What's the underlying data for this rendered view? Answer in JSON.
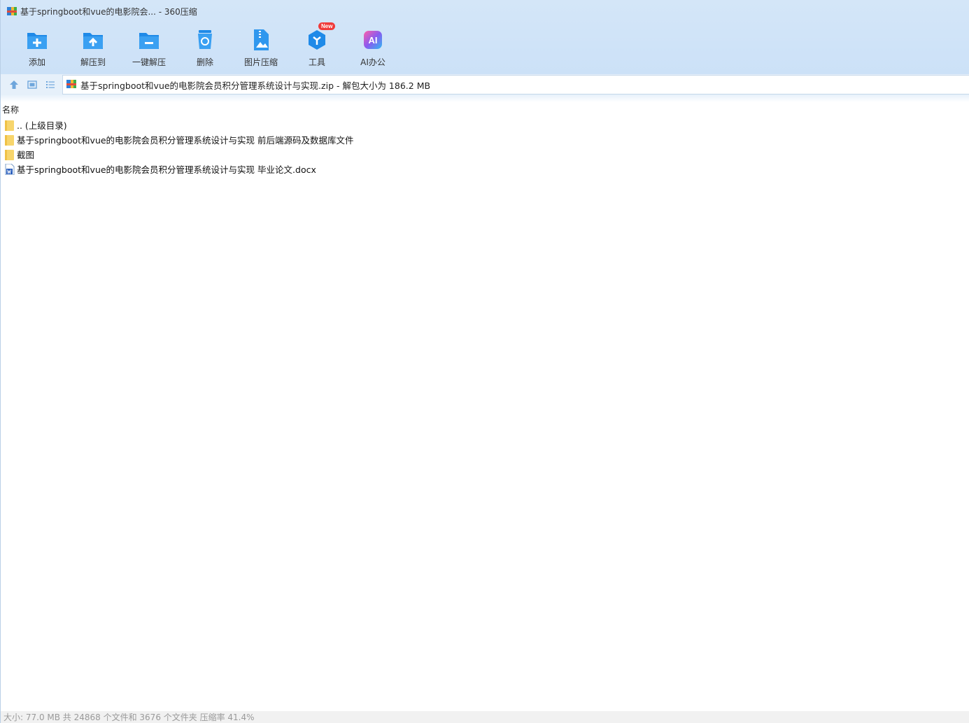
{
  "window": {
    "title": "基于springboot和vue的电影院会... - 360压缩"
  },
  "toolbar": {
    "items": [
      {
        "label": "添加",
        "icon": "add-icon"
      },
      {
        "label": "解压到",
        "icon": "extract-to-icon"
      },
      {
        "label": "一键解压",
        "icon": "one-click-extract-icon"
      },
      {
        "label": "删除",
        "icon": "delete-icon"
      },
      {
        "label": "图片压缩",
        "icon": "image-compress-icon"
      },
      {
        "label": "工具",
        "icon": "tools-icon",
        "badge": "New"
      },
      {
        "label": "AI办公",
        "icon": "ai-office-icon",
        "icon_text": "AI"
      }
    ]
  },
  "address": {
    "path": "基于springboot和vue的电影院会员积分管理系统设计与实现.zip - 解包大小为 186.2 MB"
  },
  "list": {
    "column_name": "名称",
    "items": [
      {
        "name": ".. (上级目录)",
        "type": "folder",
        "icon": "folder-icon"
      },
      {
        "name": "基于springboot和vue的电影院会员积分管理系统设计与实现 前后端源码及数据库文件",
        "type": "folder",
        "icon": "folder-icon"
      },
      {
        "name": "截图",
        "type": "folder",
        "icon": "folder-icon"
      },
      {
        "name": "基于springboot和vue的电影院会员积分管理系统设计与实现 毕业论文.docx",
        "type": "docx",
        "icon": "word-doc-icon"
      }
    ]
  },
  "status": {
    "text": "大小: 77.0 MB 共 24868 个文件和 3676 个文件夹 压缩率 41.4%"
  },
  "colors": {
    "accent_blue": "#1f8ae8",
    "toolbar_bg": "#d4e6f8",
    "folder_yellow": "#f7d56c",
    "badge_red": "#f03a3a",
    "word_blue": "#2b5fbe"
  }
}
